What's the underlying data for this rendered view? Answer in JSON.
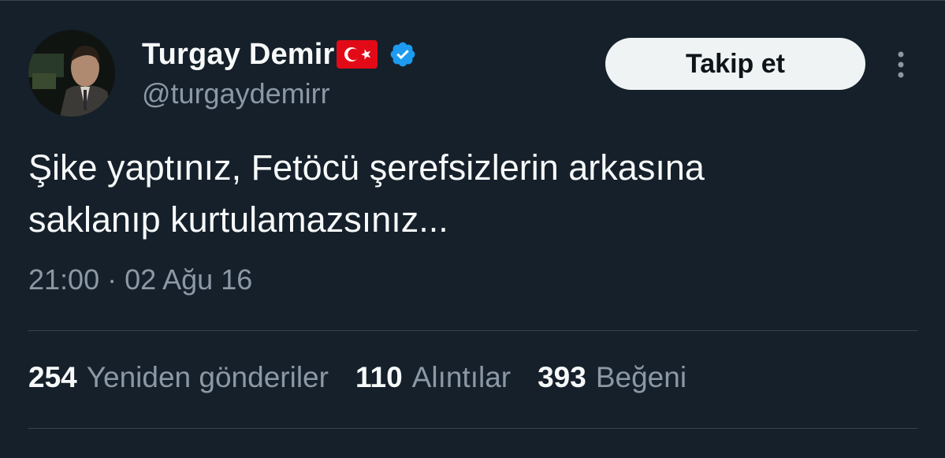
{
  "user": {
    "display_name": "Turgay Demir",
    "handle": "@turgaydemirr",
    "flag_icon": "turkey-flag-icon",
    "verified_icon": "verified-badge-icon",
    "verified_color": "#1d9bf0"
  },
  "follow_button": {
    "label": "Takip et"
  },
  "more_button": {
    "icon": "more-vertical-icon"
  },
  "tweet": {
    "lines": [
      "Şike yaptınız, Fetöcü şerefsizlerin arkasına",
      "saklanıp kurtulamazsınız..."
    ],
    "timestamp": "21:00 · 02 Ağu 16"
  },
  "stats": [
    {
      "count": "254",
      "label": "Yeniden gönderiler"
    },
    {
      "count": "110",
      "label": "Alıntılar"
    },
    {
      "count": "393",
      "label": "Beğeni"
    }
  ],
  "colors": {
    "background": "#15202b",
    "primary_text": "#f7f9f9",
    "secondary_text": "#8b98a5",
    "divider": "#38444d",
    "follow_button_bg": "#eff3f4",
    "flag_red": "#e30a17"
  }
}
